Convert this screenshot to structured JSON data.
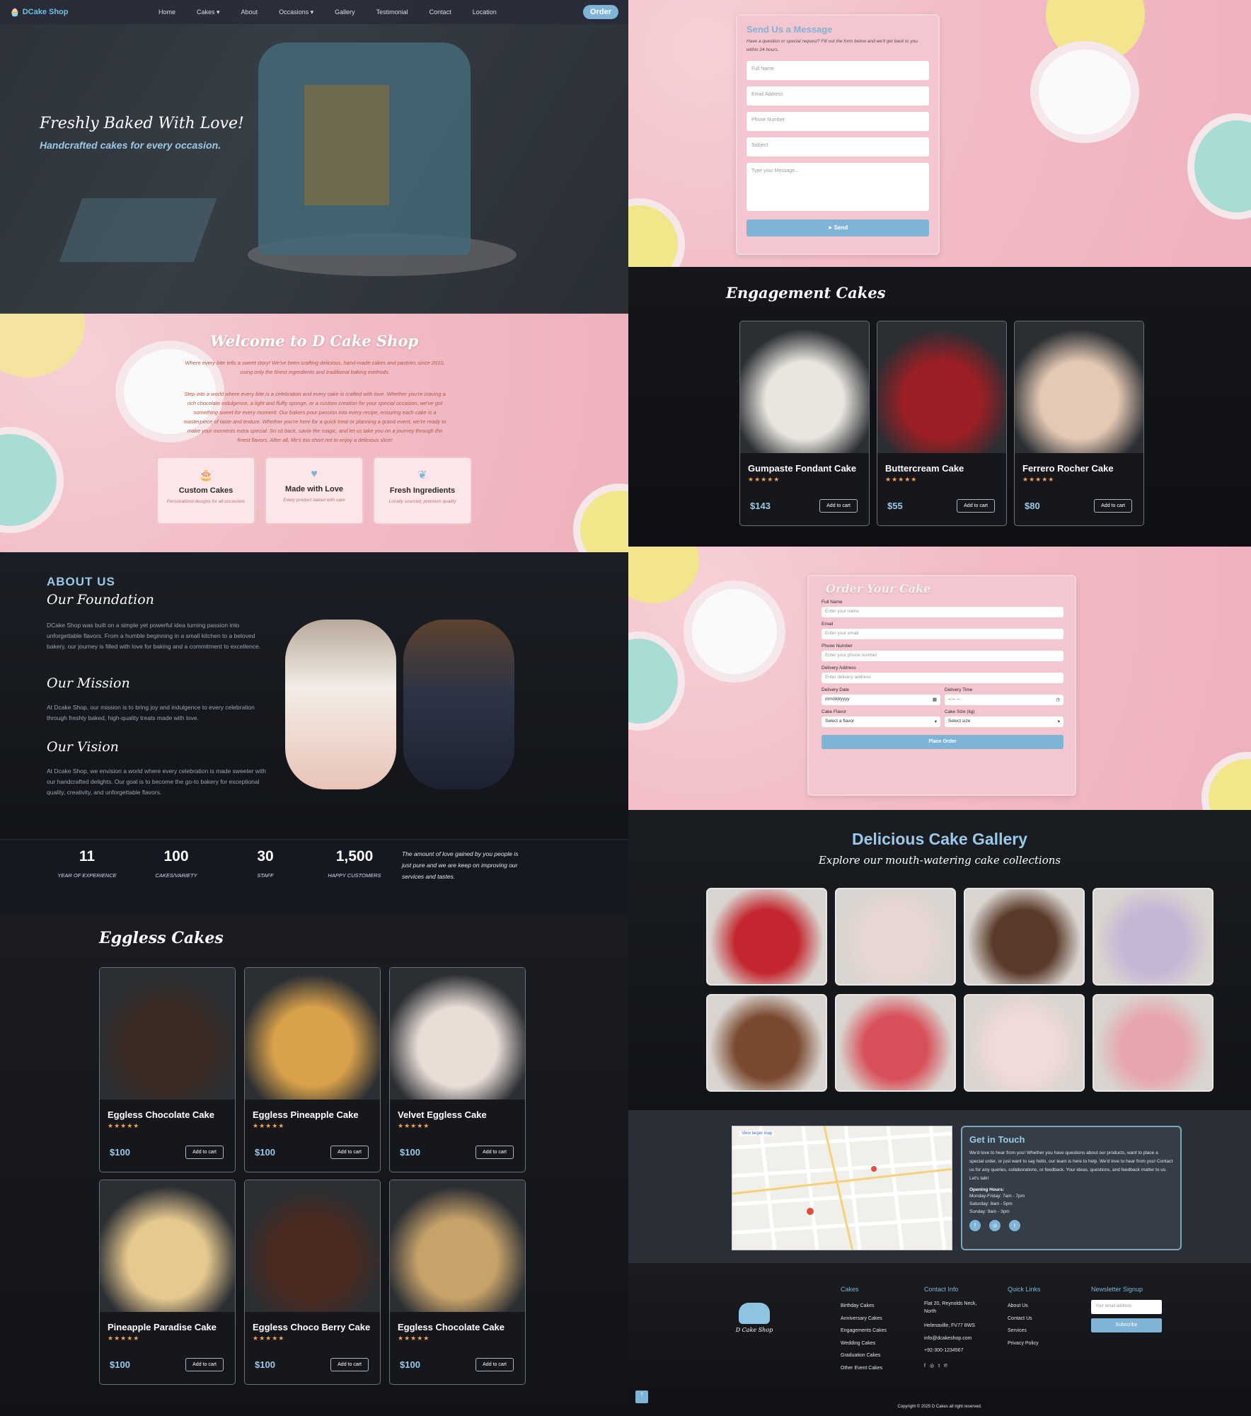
{
  "nav": {
    "brand": "DCake Shop",
    "links": [
      "Home",
      "Cakes ▾",
      "About",
      "Occasions ▾",
      "Gallery",
      "Testimonial",
      "Contact",
      "Location"
    ],
    "order": "Order"
  },
  "hero": {
    "title": "Freshly Baked With Love!",
    "subtitle": "Handcrafted cakes for every occasion."
  },
  "welcome": {
    "title": "Welcome to D Cake Shop",
    "p1": "Where every bite tells a sweet story! We've been crafting delicious, hand-made cakes and pastries since 2010, using only the finest ingredients and traditional baking methods.",
    "p2": "Step into a world where every bite is a celebration and every cake is crafted with love. Whether you're craving a rich chocolate indulgence, a light and fluffy sponge, or a custom creation for your special occasion, we've got something sweet for every moment. Our bakers pour passion into every recipe, ensuring each cake is a masterpiece of taste and texture. Whether you're here for a quick treat or planning a grand event, we're ready to make your moments extra special. So sit back, savor the magic, and let us take you on a journey through the finest flavors. After all, life's too short not to enjoy a delicious slice!",
    "features": [
      {
        "icon": "🎂",
        "title": "Custom Cakes",
        "desc": "Personalized designs for all occasions"
      },
      {
        "icon": "♥",
        "title": "Made with Love",
        "desc": "Every product baked with care"
      },
      {
        "icon": "❦",
        "title": "Fresh Ingredients",
        "desc": "Locally sourced, premium quality"
      }
    ]
  },
  "about": {
    "label": "ABOUT US",
    "foundation_title": "Our Foundation",
    "foundation": "DCake Shop was built on a simple yet powerful idea turning passion into unforgettable flavors. From a humble beginning in a small kitchen to a beloved bakery, our journey is filled with love for baking and a commitment to excellence.",
    "mission_title": "Our Mission",
    "mission": "At Dcake Shop, our mission is to bring joy and indulgence to every celebration through freshly baked, high-quality treats made with love.",
    "vision_title": "Our Vision",
    "vision": "At Dcake Shop, we envision a world where every celebration is made sweeter with our handcrafted delights. Our goal is to become the go-to bakery for exceptional quality, creativity, and unforgettable flavors."
  },
  "stats": [
    {
      "n": "11",
      "l": "YEAR OF EXPERIENCE"
    },
    {
      "n": "100",
      "l": "CAKES/VARIETY"
    },
    {
      "n": "30",
      "l": "STAFF"
    },
    {
      "n": "1,500",
      "l": "HAPPY CUSTOMERS"
    }
  ],
  "stats_quote": "The amount of love gained by you people is just pure and we are keep on improving our services and tastes.",
  "eggless": {
    "title": "Eggless Cakes",
    "items": [
      {
        "name": "Eggless Chocolate Cake",
        "stars": "★★★★★",
        "price": "$100",
        "btn": "Add to cart",
        "color": "#3b2a22"
      },
      {
        "name": "Eggless Pineapple Cake",
        "stars": "★★★★★",
        "price": "$100",
        "btn": "Add to cart",
        "color": "#d8a14a"
      },
      {
        "name": "Velvet Eggless Cake",
        "stars": "★★★★★",
        "price": "$100",
        "btn": "Add to cart",
        "color": "#e9ddd6"
      },
      {
        "name": "Pineapple Paradise Cake",
        "stars": "★★★★★",
        "price": "$100",
        "btn": "Add to cart",
        "color": "#e6c98f"
      },
      {
        "name": "Eggless Choco Berry Cake",
        "stars": "★★★★★",
        "price": "$100",
        "btn": "Add to cart",
        "color": "#4a2a20"
      },
      {
        "name": "Eggless Chocolate Cake",
        "stars": "★★★★★",
        "price": "$100",
        "btn": "Add to cart",
        "color": "#c7a36a"
      }
    ]
  },
  "contact": {
    "title": "Send Us a Message",
    "desc": "Have a question or special request? Fill out the form below and we'll get back to you within 24 hours.",
    "fields": [
      "Full Name",
      "Email Address",
      "Phone Number",
      "Subject"
    ],
    "message": "Type your Message...",
    "send": "Send"
  },
  "engagement": {
    "title": "Engagement Cakes",
    "items": [
      {
        "name": "Gumpaste Fondant Cake",
        "stars": "★★★★★",
        "price": "$143",
        "btn": "Add to cart",
        "color": "#e9e6df"
      },
      {
        "name": "Buttercream Cake",
        "stars": "★★★★★",
        "price": "$55",
        "btn": "Add to cart",
        "color": "#9b1f24"
      },
      {
        "name": "Ferrero Rocher Cake",
        "stars": "★★★★★",
        "price": "$80",
        "btn": "Add to cart",
        "color": "#e4c9b4"
      }
    ]
  },
  "order": {
    "title": "Order Your Cake",
    "name_label": "Full Name",
    "name_ph": "Enter your name",
    "email_label": "Email",
    "email_ph": "Enter your email",
    "phone_label": "Phone Number",
    "phone_ph": "Enter your phone number",
    "addr_label": "Delivery Address",
    "addr_ph": "Enter delivery address",
    "date_label": "Delivery Date",
    "date_val": "mm/dd/yyyy",
    "time_label": "Delivery Time",
    "time_val": "--:-- --",
    "flavor_label": "Cake Flavor",
    "flavor_val": "Select a flavor",
    "size_label": "Cake Size (kg)",
    "size_val": "Select size",
    "submit": "Place Order"
  },
  "gallery": {
    "title": "Delicious Cake Gallery",
    "subtitle": "Explore our mouth-watering cake collections",
    "colors": [
      "#c3262e",
      "#e9d7d3",
      "#5a3a2a",
      "#c6b6d6",
      "#7a4a30",
      "#d8505a",
      "#f1dada",
      "#e7a6ae"
    ]
  },
  "location": {
    "map_link": "View larger map",
    "title": "Get in Touch",
    "desc": "We'd love to hear from you! Whether you have questions about our products, want to place a special order, or just want to say hello, our team is here to help. We'd love to hear from you! Contact us for any queries, collaborations, or feedback. Your ideas, questions, and feedback matter to us. Let's talk!",
    "hours_title": "Opening Hours:",
    "hours": [
      "Monday-Friday: 7am - 7pm",
      "Saturday: 8am - 5pm",
      "Sunday: 9am - 3pm"
    ]
  },
  "footer": {
    "logo_text": "D Cake Shop",
    "cakes_title": "Cakes",
    "cakes": [
      "Birthday Cakes",
      "Anniversary Cakes",
      "Engagements Cakes",
      "Wedding Cakes",
      "Graduation Cakes",
      "Other Event Cakes"
    ],
    "contact_title": "Contact Info",
    "contact": [
      "Flat 20, Reynolds Neck, North",
      "Helenaville, FV77 8WS",
      "info@dcakeshop.com",
      "+92-300-1234567"
    ],
    "links_title": "Quick Links",
    "links": [
      "About Us",
      "Contact Us",
      "Services",
      "Privacy Policy"
    ],
    "news_title": "Newsletter Signup",
    "news_ph": "Your email address",
    "subscribe": "Subscribe",
    "copyright": "Copyright © 2025 D Cakes all right reserved."
  }
}
